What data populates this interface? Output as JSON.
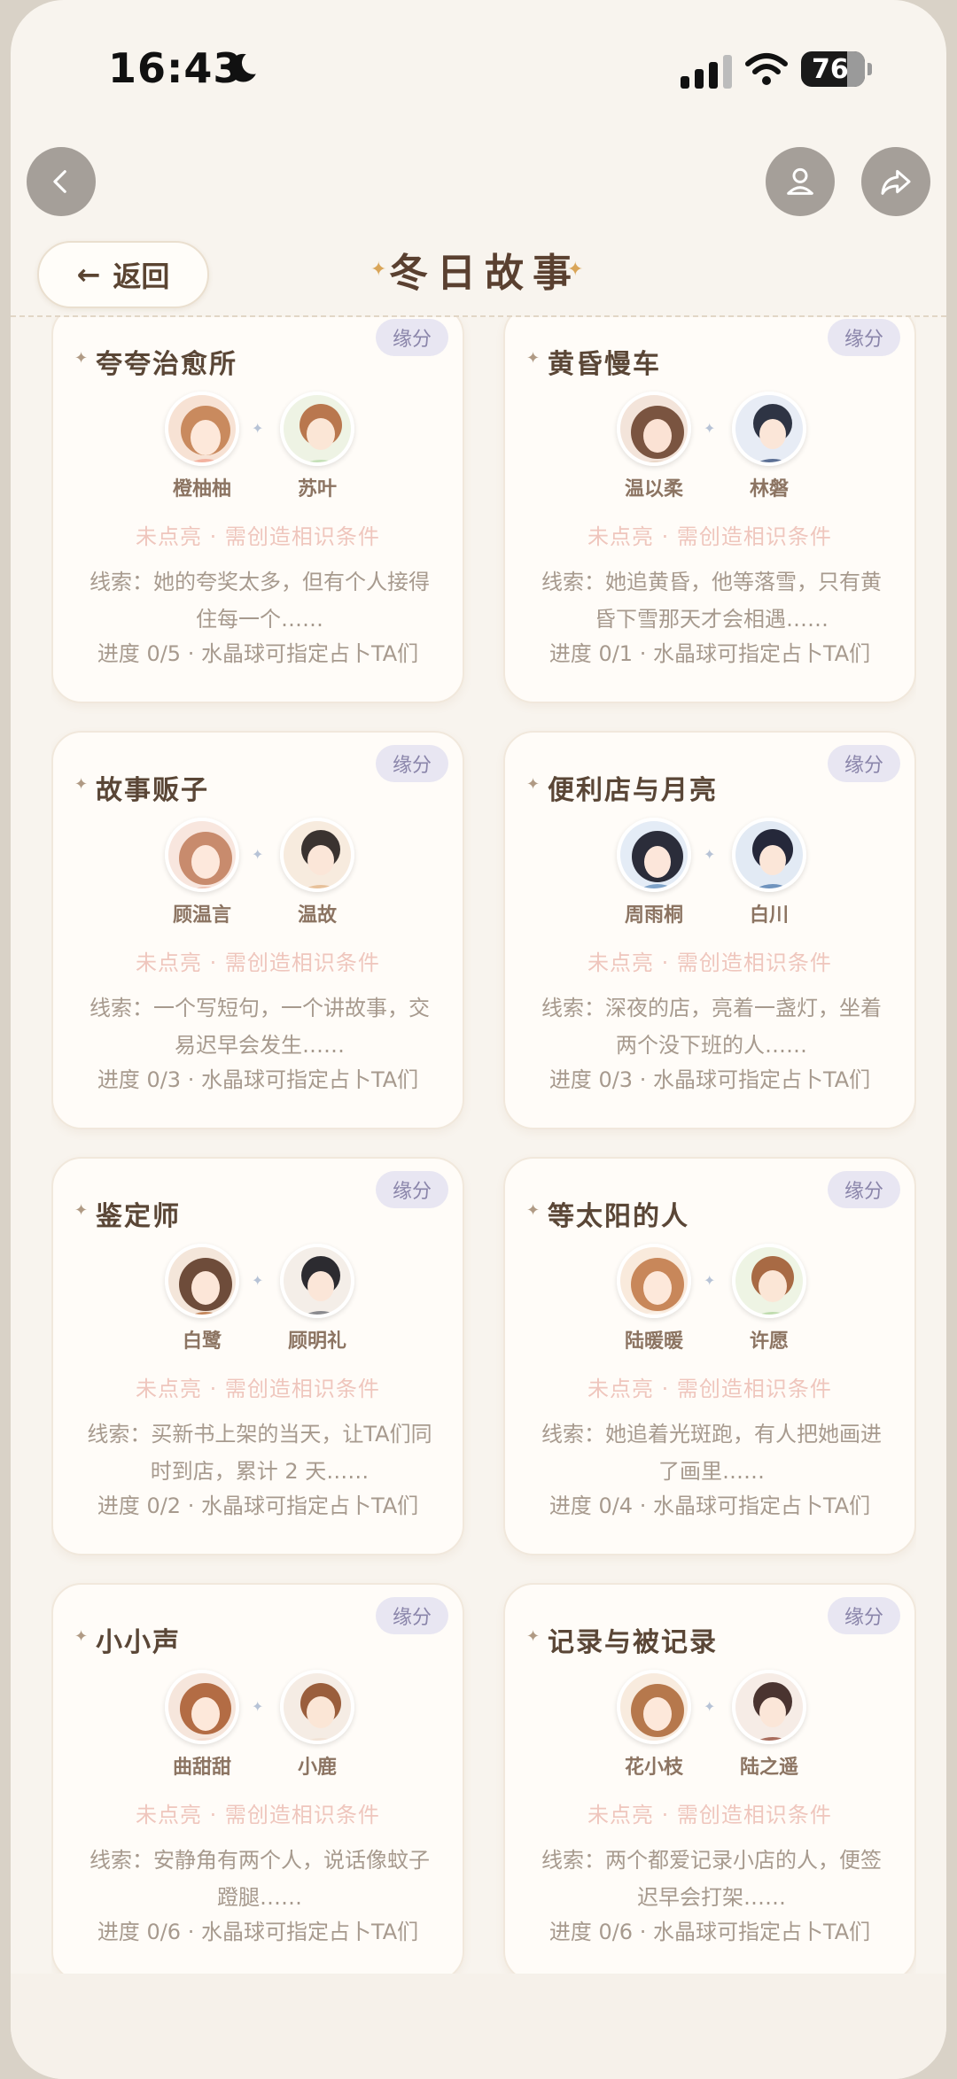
{
  "status_bar": {
    "time": "16:43",
    "battery": "76"
  },
  "header": {
    "back_label": "返回",
    "title": "冬日故事"
  },
  "card_common": {
    "badge": "缘分",
    "status": "未点亮 · 需创造相识条件"
  },
  "cards": [
    {
      "title": "夸夸治愈所",
      "names": [
        "橙柚柚",
        "苏叶"
      ],
      "clue": "线索：她的夸奖太多，但有个人接得住每一个……",
      "progress": "进度 0/5 · 水晶球可指定占卜TA们",
      "colors": [
        "#c98a5e",
        "#b9774e"
      ]
    },
    {
      "title": "黄昏慢车",
      "names": [
        "温以柔",
        "林磐"
      ],
      "clue": "线索：她追黄昏，他等落雪，只有黄昏下雪那天才会相遇……",
      "progress": "进度 0/1 · 水晶球可指定占卜TA们",
      "colors": [
        "#7a5440",
        "#2e3444"
      ]
    },
    {
      "title": "故事贩子",
      "names": [
        "顾温言",
        "温故"
      ],
      "clue": "线索：一个写短句，一个讲故事，交易迟早会发生……",
      "progress": "进度 0/3 · 水晶球可指定占卜TA们",
      "colors": [
        "#c88b6d",
        "#3a3330"
      ]
    },
    {
      "title": "便利店与月亮",
      "names": [
        "周雨桐",
        "白川"
      ],
      "clue": "线索：深夜的店，亮着一盏灯，坐着两个没下班的人……",
      "progress": "进度 0/3 · 水晶球可指定占卜TA们",
      "colors": [
        "#2b2d3a",
        "#25283a"
      ]
    },
    {
      "title": "鉴定师",
      "names": [
        "白鹭",
        "顾明礼"
      ],
      "clue": "线索：买新书上架的当天，让TA们同时到店，累计 2 天……",
      "progress": "进度 0/2 · 水晶球可指定占卜TA们",
      "colors": [
        "#6e4c3a",
        "#2c2b30"
      ]
    },
    {
      "title": "等太阳的人",
      "names": [
        "陆暖暖",
        "许愿"
      ],
      "clue": "线索：她追着光斑跑，有人把她画进了画里……",
      "progress": "进度 0/4 · 水晶球可指定占卜TA们",
      "colors": [
        "#c8875a",
        "#a86a44"
      ]
    },
    {
      "title": "小小声",
      "names": [
        "曲甜甜",
        "小鹿"
      ],
      "clue": "线索：安静角有两个人，说话像蚊子蹬腿……",
      "progress": "进度 0/6 · 水晶球可指定占卜TA们",
      "colors": [
        "#b36c44",
        "#9a5e3c"
      ]
    },
    {
      "title": "记录与被记录",
      "names": [
        "花小枝",
        "陆之遥"
      ],
      "clue": "线索：两个都爱记录小店的人，便签迟早会打架……",
      "progress": "进度 0/6 · 水晶球可指定占卜TA们",
      "colors": [
        "#b6784c",
        "#4a3430"
      ]
    }
  ]
}
